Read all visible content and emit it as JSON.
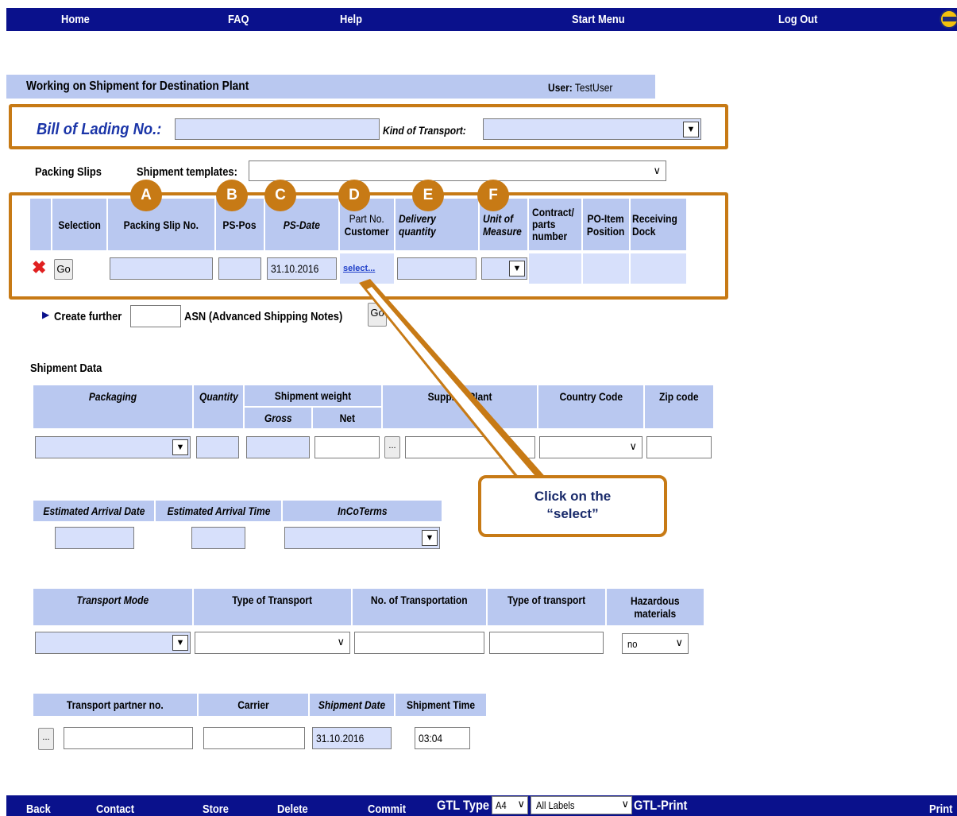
{
  "nav": {
    "home": "Home",
    "faq": "FAQ",
    "help": "Help",
    "start_menu": "Start Menu",
    "log_out": "Log Out",
    "logo_icon": "hella-logo-icon"
  },
  "title": {
    "heading": "Working on Shipment for Destination Plant",
    "user_label": "User:",
    "user_value": "TestUser"
  },
  "bol": {
    "label": "Bill of Lading No.:",
    "value": "",
    "transport_label": "Kind of Transport:",
    "transport_value": ""
  },
  "packing": {
    "label": "Packing Slips",
    "templates_label": "Shipment templates:",
    "templates_value": ""
  },
  "markers": [
    "A",
    "B",
    "C",
    "D",
    "E",
    "F"
  ],
  "ps_table": {
    "headers": {
      "selection": "Selection",
      "slip_no": "Packing Slip No.",
      "ps_pos": "PS-Pos",
      "ps_date": "PS-Date",
      "part_no_1": "Part No.",
      "part_no_2": "Customer",
      "delivery_1": "Delivery",
      "delivery_2": "quantity",
      "unit_1": "Unit of",
      "unit_2": "Measure",
      "contract_1": "Contract/",
      "contract_2": "parts",
      "contract_3": "number",
      "po_1": "PO-Item",
      "po_2": "Position",
      "recv_1": "Receiving",
      "recv_2": "Dock"
    },
    "row": {
      "delete_icon": "red-x-icon",
      "go": "Go",
      "slip_no": "",
      "ps_pos": "",
      "ps_date": "31.10.2016",
      "select_link": "select...",
      "delivery_qty": ""
    }
  },
  "create_further": {
    "arrow_icon": "triangle-right-icon",
    "label": "Create further",
    "value": "",
    "suffix": "ASN (Advanced Shipping Notes)",
    "go": "Go"
  },
  "shipment_data": {
    "label": "Shipment Data",
    "headers": {
      "packaging": "Packaging",
      "quantity": "Quantity",
      "weight": "Shipment weight",
      "gross": "Gross",
      "net": "Net",
      "supplier_plant": "Supplier Plant",
      "country_code": "Country Code",
      "zip": "Zip code"
    },
    "browse": "..."
  },
  "arrival": {
    "date": "Estimated Arrival Date",
    "time": "Estimated Arrival Time",
    "incoterms": "InCoTerms"
  },
  "callout": {
    "line1": "Click on the",
    "line2": "“select”"
  },
  "transport": {
    "mode": "Transport Mode",
    "type": "Type of Transport",
    "number": "No. of Transportation",
    "type2": "Type of transport",
    "hazardous_1": "Hazardous",
    "hazardous_2": "materials",
    "hazardous_value": "no"
  },
  "partner": {
    "partner_no": "Transport partner no.",
    "carrier": "Carrier",
    "ship_date": "Shipment Date",
    "ship_time": "Shipment Time",
    "browse": "...",
    "ship_date_value": "31.10.2016",
    "ship_time_value": "03:04"
  },
  "bottom": {
    "back": "Back",
    "contact": "Contact",
    "store": "Store",
    "delete": "Delete",
    "commit": "Commit",
    "gtl_type": "GTL Type",
    "paper_value": "A4",
    "labels_value": "All Labels",
    "gtl_print": "GTL-Print",
    "print": "Print"
  },
  "colors": {
    "nav": "#0a118c",
    "header_cell": "#b9c8f0",
    "input_light": "#d7e0fb",
    "highlight": "#c77a15",
    "link": "#1f3fc9"
  }
}
